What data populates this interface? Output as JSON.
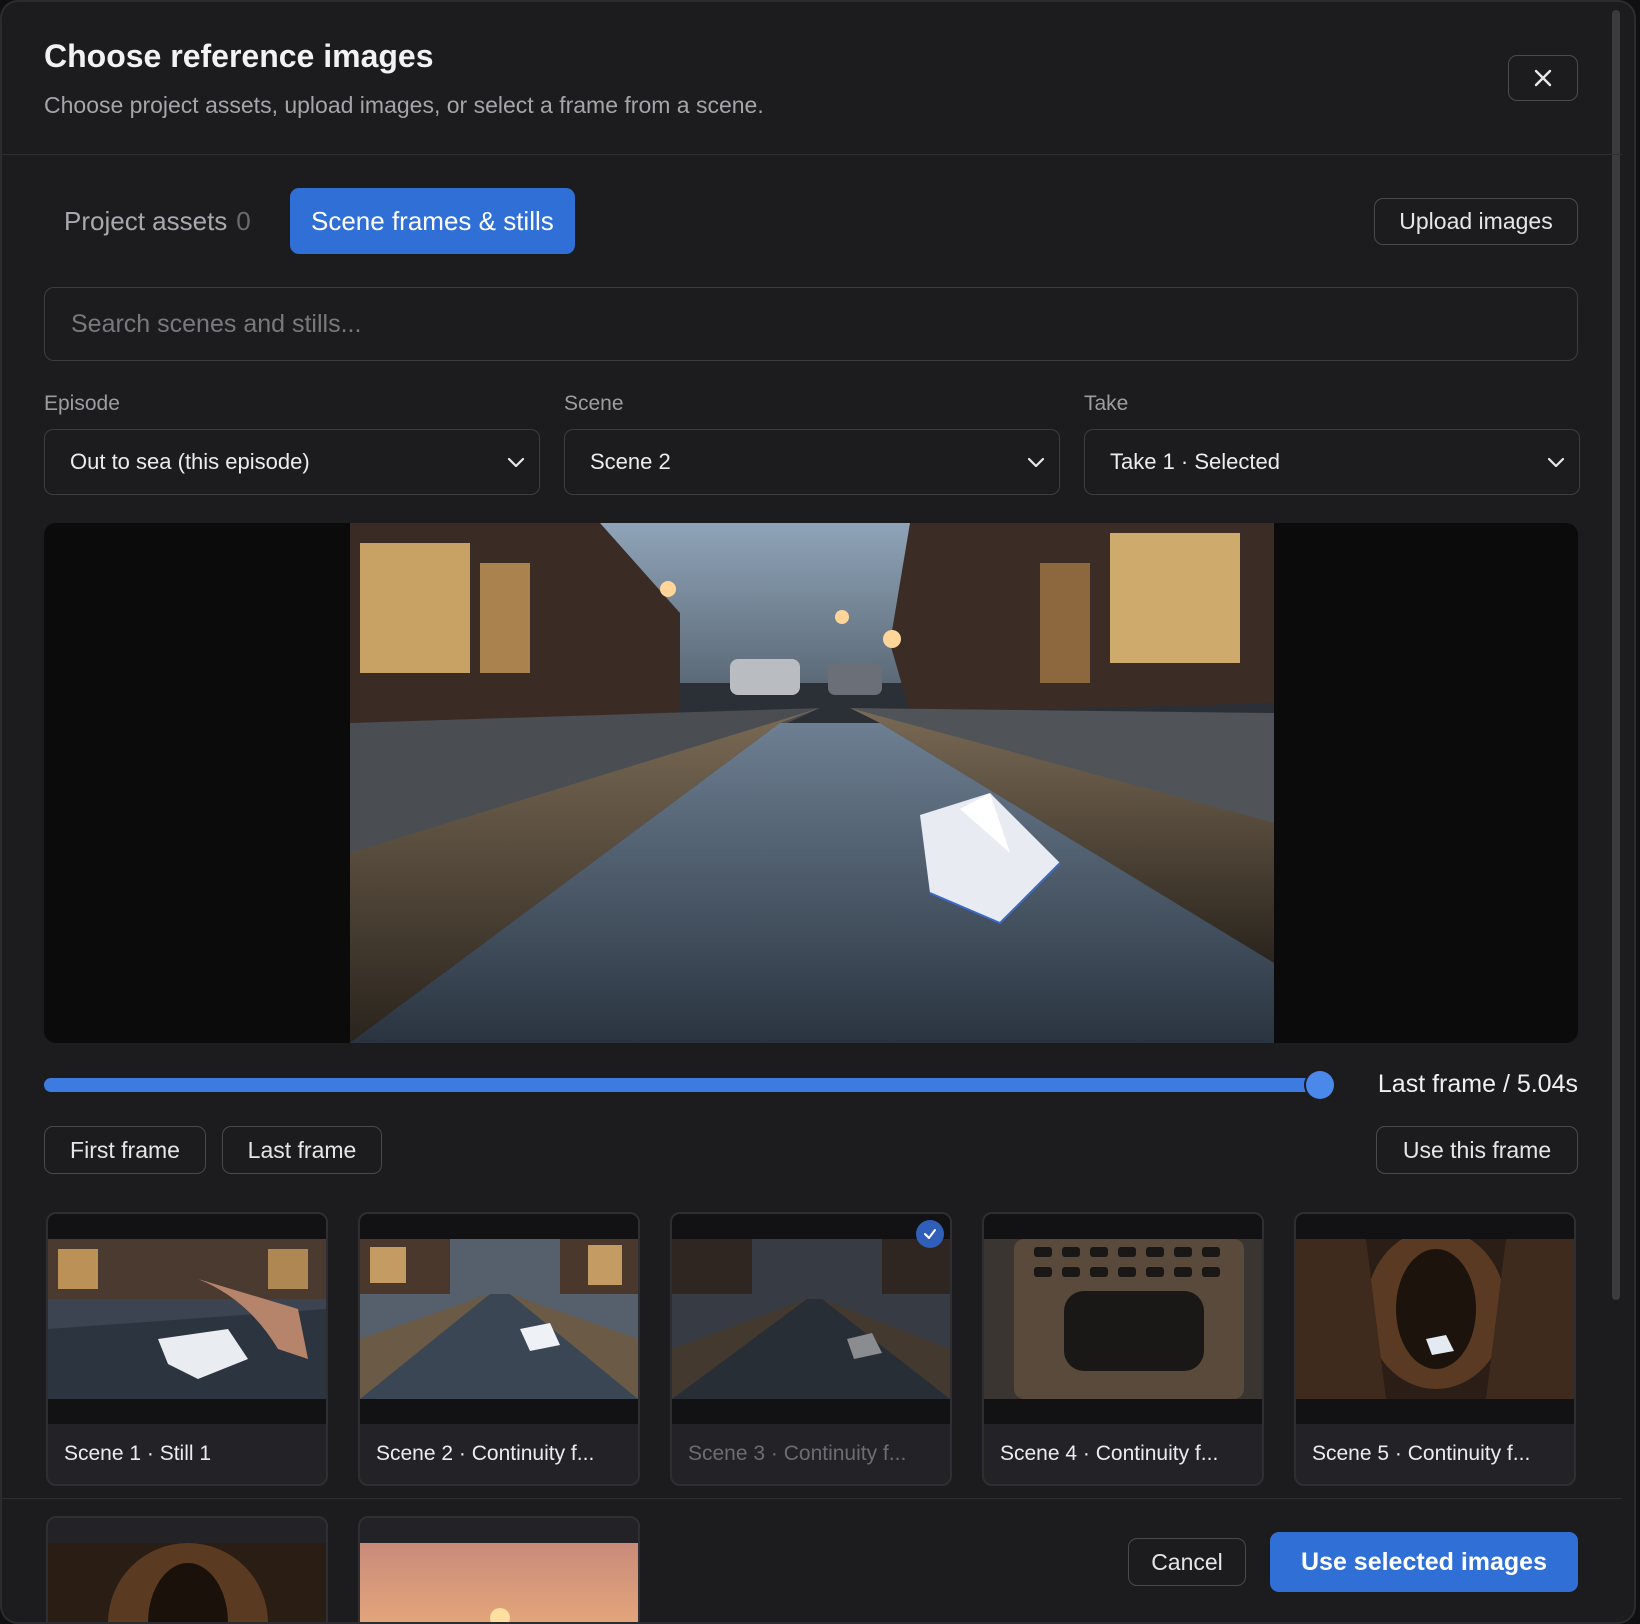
{
  "dialog": {
    "title": "Choose reference images",
    "subtitle": "Choose project assets, upload images, or select a frame from a scene.",
    "close_icon": "close-icon"
  },
  "tabs": {
    "assets_label": "Project assets",
    "assets_count": "0",
    "frames_label": "Scene frames & stills",
    "active": "frames"
  },
  "upload_label": "Upload images",
  "search": {
    "placeholder": "Search scenes and stills..."
  },
  "filters": {
    "episode": {
      "label": "Episode",
      "value": "Out to sea (this episode)"
    },
    "scene": {
      "label": "Scene",
      "value": "Scene 2"
    },
    "take": {
      "label": "Take",
      "value": "Take 1 · Selected"
    }
  },
  "scrubber": {
    "progress": 1.0,
    "readout": "Last frame / 5.04s"
  },
  "frame_buttons": {
    "first": "First frame",
    "last": "Last frame",
    "use": "Use this frame"
  },
  "stills": [
    {
      "caption": "Scene 1 · Still 1",
      "selected": false
    },
    {
      "caption": "Scene 2 · Continuity f...",
      "selected": false
    },
    {
      "caption": "Scene 3 · Continuity f...",
      "selected": true
    },
    {
      "caption": "Scene 4 · Continuity f...",
      "selected": false
    },
    {
      "caption": "Scene 5 · Continuity f...",
      "selected": false
    }
  ],
  "footer": {
    "cancel": "Cancel",
    "confirm": "Use selected images"
  },
  "colors": {
    "accent": "#2f6fd6",
    "background": "#1c1c1f",
    "border": "#3c3c42"
  }
}
